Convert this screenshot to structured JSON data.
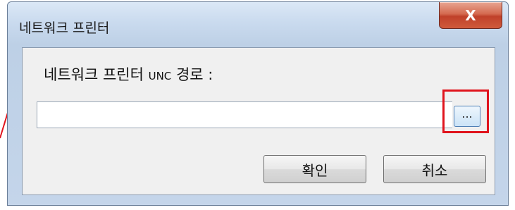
{
  "window": {
    "title": "네트워크 프린터",
    "close_label": "X"
  },
  "dialog": {
    "label_prefix": "네트워크 프린터 ",
    "label_unc": "UNC",
    "label_suffix": " 경로 :",
    "path_value": "",
    "browse_label": "...",
    "ok_label": "확인",
    "cancel_label": "취소"
  },
  "colors": {
    "highlight": "#e0141d",
    "close_button": "#c0412a"
  }
}
